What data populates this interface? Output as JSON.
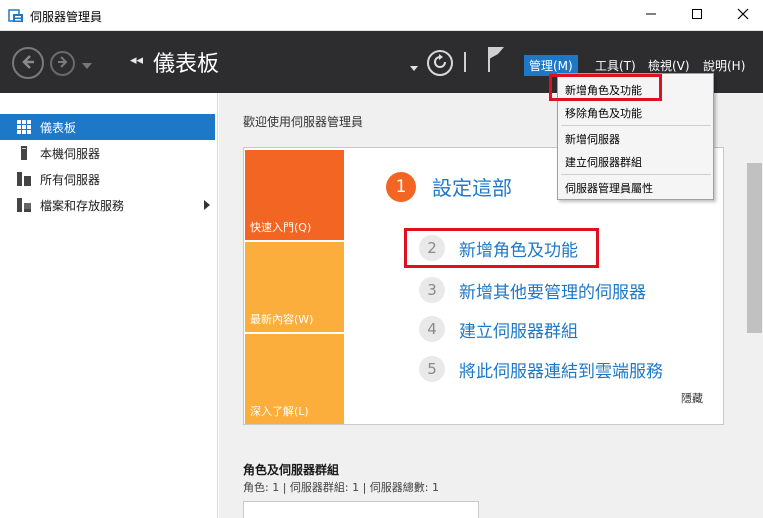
{
  "window": {
    "title": "伺服器管理員",
    "minimize": "—",
    "maximize": "☐",
    "close": "✕"
  },
  "toolbar": {
    "crumb_arrows": "◂◂",
    "title": "儀表板",
    "menus": [
      "管理(M)",
      "工具(T)",
      "檢視(V)",
      "說明(H)"
    ]
  },
  "sidebar": {
    "items": [
      {
        "label": "儀表板",
        "icon": "dashboard-icon",
        "active": true
      },
      {
        "label": "本機伺服器",
        "icon": "server-icon",
        "active": false
      },
      {
        "label": "所有伺服器",
        "icon": "servers-icon",
        "active": false
      },
      {
        "label": "檔案和存放服務",
        "icon": "storage-icon",
        "active": false,
        "has_children": true
      }
    ]
  },
  "main": {
    "welcome": "歡迎使用伺服器管理員",
    "tiles": [
      "快速入門(Q)",
      "最新內容(W)",
      "深入了解(L)"
    ],
    "step1_num": "1",
    "step1_text": "設定這部",
    "steps": [
      {
        "num": "2",
        "text": "新增角色及功能"
      },
      {
        "num": "3",
        "text": "新增其他要管理的伺服器"
      },
      {
        "num": "4",
        "text": "建立伺服器群組"
      },
      {
        "num": "5",
        "text": "將此伺服器連結到雲端服務"
      }
    ],
    "hide": "隱藏",
    "roles_title": "角色及伺服器群組",
    "roles_sub": "角色: 1 | 伺服器群組: 1 | 伺服器總數: 1"
  },
  "dropdown": {
    "items": [
      "新增角色及功能",
      "移除角色及功能",
      "新增伺服器",
      "建立伺服器群組",
      "伺服器管理員屬性"
    ]
  },
  "colors": {
    "accent": "#1e78c8",
    "toolbar_bg": "#2d2d30",
    "tile_primary": "#f26522",
    "tile_secondary": "#fbae3c",
    "highlight": "#e0101e"
  }
}
